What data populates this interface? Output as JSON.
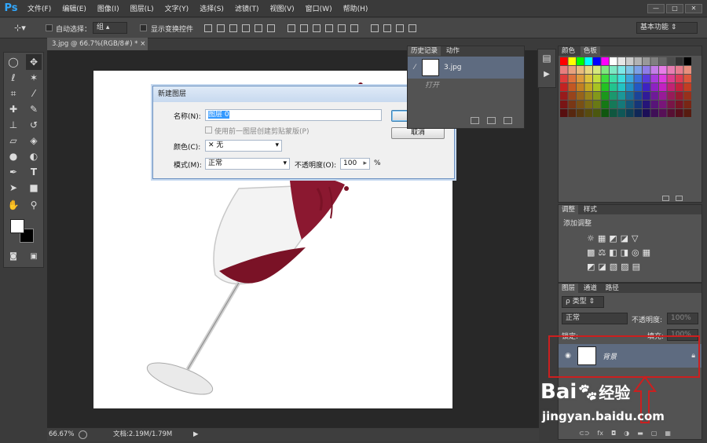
{
  "app": {
    "logo": "Ps"
  },
  "menu": [
    "文件(F)",
    "编辑(E)",
    "图像(I)",
    "图层(L)",
    "文字(Y)",
    "选择(S)",
    "滤镜(T)",
    "视图(V)",
    "窗口(W)",
    "帮助(H)"
  ],
  "window_controls": {
    "minimize": "—",
    "restore": "□",
    "close": "✕"
  },
  "options": {
    "auto_select_label": "自动选择：",
    "auto_select_value": "组",
    "show_transform_label": "显示变换控件",
    "workspace": "基本功能"
  },
  "document": {
    "tab_title": "3.jpg @ 66.7%(RGB/8#) *",
    "tab_close": "×",
    "zoom": "66.67%",
    "doc_info": "文档:2.19M/1.79M"
  },
  "dialog": {
    "title": "新建图层",
    "close_glyph": "✕",
    "name_label": "名称(N):",
    "name_value": "图层 0",
    "clip_label": "使用前一图层创建剪贴蒙版(P)",
    "color_label": "颜色(C):",
    "color_value": "无",
    "mode_label": "模式(M):",
    "mode_value": "正常",
    "opacity_label": "不透明度(O):",
    "opacity_value": "100",
    "opacity_unit": "%",
    "ok": "确定",
    "cancel": "取消"
  },
  "history_panel": {
    "tabs": [
      "历史记录",
      "动作"
    ],
    "item": "3.jpg",
    "sub_item": "打开"
  },
  "swatches_panel": {
    "tabs": [
      "颜色",
      "色板"
    ]
  },
  "adjustments_panel": {
    "tabs": [
      "调整",
      "样式"
    ],
    "add_label": "添加调整"
  },
  "layers_panel": {
    "tabs": [
      "图层",
      "通道",
      "路径"
    ],
    "filter_label": "ρ 类型",
    "blend_mode": "正常",
    "opacity_label": "不透明度:",
    "opacity_value": "100%",
    "lock_label": "锁定:",
    "fill_label": "填充:",
    "fill_value": "100%",
    "layer_name": "背景"
  },
  "watermark": {
    "brand": "Bai",
    "brand_cn": "经验",
    "url": "jingyan.baidu.com"
  },
  "colors": {
    "accent": "#cc1f1f",
    "dialog_bg": "#f0f0f0",
    "panel_bg": "#535353"
  }
}
